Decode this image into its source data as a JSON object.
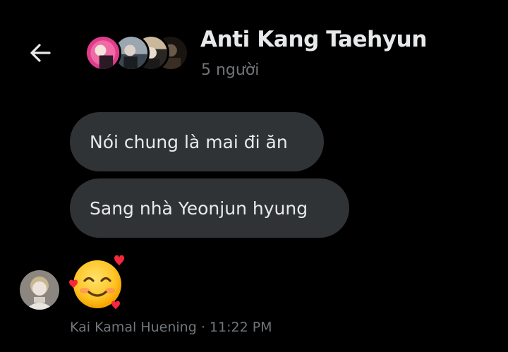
{
  "header": {
    "back_icon": "arrow-left-icon",
    "title": "Anti Kang Taehyun",
    "subtitle": "5 người"
  },
  "messages": [
    {
      "text": "Nói chung là mai đi ăn"
    },
    {
      "text": "Sang nhà Yeonjun hyung"
    },
    {
      "emoji": "smiling-face-with-hearts",
      "glyph": "🥰"
    }
  ],
  "message_meta": {
    "sender": "Kai Kamal Huening",
    "separator": "·",
    "time": "11:22 PM"
  },
  "colors": {
    "background": "#000000",
    "bubble": "#2f3336",
    "text_primary": "#e7e9ea",
    "text_secondary": "#71767b"
  }
}
